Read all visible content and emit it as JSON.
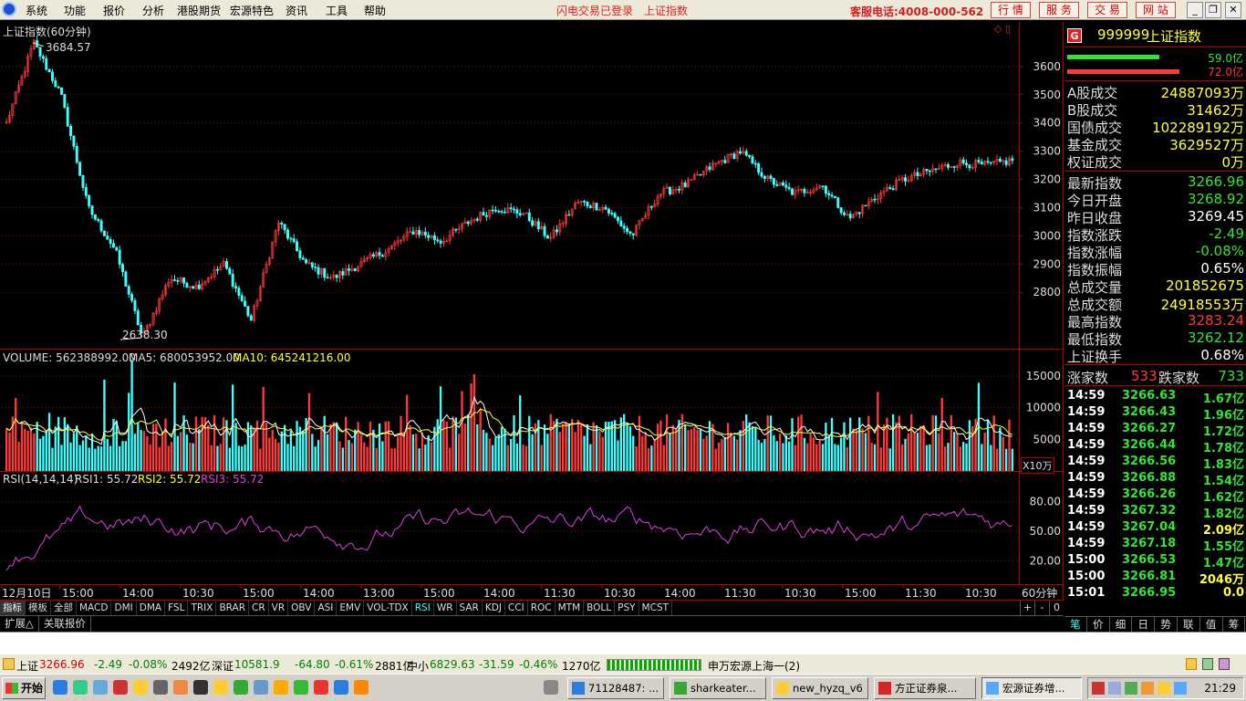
{
  "menubar": {
    "items": [
      "系统",
      "功能",
      "报价",
      "分析",
      "港股期货",
      "宏源特色",
      "资讯",
      "工具",
      "帮助"
    ],
    "status": "闪电交易已登录",
    "index_name": "上证指数",
    "hotline": "客服电话:4008-000-562",
    "buttons": [
      "行  情",
      "服  务",
      "交  易",
      "网  站"
    ],
    "window_buttons": [
      "_",
      "❐",
      "✕"
    ]
  },
  "chart": {
    "title": "上证指数(60分钟)",
    "top_icons": "◇ ▯",
    "high_label": "3684.57",
    "low_label": "2638.30",
    "volume_title": {
      "label": "VOLUME: 562388992.00",
      "ma5": "MA5: 680053952.00",
      "ma10": "MA10: 645241216.00"
    },
    "volume_unit": "X10万",
    "rsi_title": {
      "label": "RSI(14,14,14)",
      "rsi1": "RSI1: 55.72",
      "rsi2": "RSI2: 55.72",
      "rsi3": "RSI3: 55.72"
    },
    "period": "60分钟",
    "time_labels": [
      "12月10日",
      "15:00",
      "14:00",
      "10:30",
      "15:00",
      "14:00",
      "13:00",
      "15:00",
      "14:00",
      "11:30",
      "10:30",
      "14:00",
      "11:30",
      "10:30",
      "15:00",
      "11:30",
      "10:30"
    ]
  },
  "colors": {
    "up": "#ff3a3a",
    "down": "#40ffff",
    "grid": "#8a1010",
    "ma5": "#ffffff",
    "ma10": "#ffff40",
    "rsi": "#e040e0"
  },
  "chart_data": [
    {
      "type": "candlestick",
      "title": "上证指数(60分钟)",
      "y_ticks": [
        3600,
        3500,
        3400,
        3300,
        3200,
        3100,
        3000,
        2900,
        2800
      ],
      "ylim": [
        2600,
        3700
      ],
      "high": 3684.57,
      "low": 2638.3,
      "last": 3266.96,
      "trend_keypoints": [
        3400,
        3684.57,
        3500,
        3100,
        2950,
        2638.3,
        2850,
        2820,
        2900,
        2700,
        3050,
        2900,
        2850,
        2900,
        2950,
        3020,
        2980,
        3050,
        3100,
        3080,
        2990,
        3120,
        3100,
        3000,
        3150,
        3180,
        3250,
        3300,
        3200,
        3150,
        3180,
        3060,
        3140,
        3200,
        3230,
        3260,
        3250,
        3266.96
      ]
    },
    {
      "type": "bar",
      "title": "VOLUME",
      "volume": 562388992.0,
      "ma5": 680053952.0,
      "ma10": 645241216.0,
      "unit": "X10万",
      "y_ticks": [
        15000,
        10000,
        5000
      ],
      "ylim": [
        0,
        17000
      ]
    },
    {
      "type": "line",
      "title": "RSI(14,14,14)",
      "series": [
        {
          "name": "RSI1",
          "last": 55.72
        },
        {
          "name": "RSI2",
          "last": 55.72
        },
        {
          "name": "RSI3",
          "last": 55.72
        }
      ],
      "y_ticks": [
        "80.00",
        "50.00",
        "20.00"
      ],
      "ylim": [
        0,
        100
      ]
    }
  ],
  "indicator_tabs": [
    "指标",
    "模板",
    "全部",
    "MACD",
    "DMI",
    "DMA",
    "FSL",
    "TRIX",
    "BRAR",
    "CR",
    "VR",
    "OBV",
    "ASI",
    "EMV",
    "VOL-TDX",
    "RSI",
    "WR",
    "SAR",
    "KDJ",
    "CCI",
    "ROC",
    "MTM",
    "BOLL",
    "PSY",
    "MCST"
  ],
  "indicator_nav": [
    "+",
    "-",
    "0"
  ],
  "sub_tabs": [
    "扩展△",
    "关联报价"
  ],
  "quote": {
    "badge": "G",
    "code": "999999",
    "name": "上证指数",
    "bar_values": [
      "59.0亿",
      "72.0亿"
    ],
    "bar_fraction": [
      0.67,
      0.82
    ],
    "rows1": [
      {
        "label": "A股成交",
        "value": "24887093万",
        "color": "yellow"
      },
      {
        "label": "B股成交",
        "value": "31462万",
        "color": "yellow"
      },
      {
        "label": "国债成交",
        "value": "102289192万",
        "color": "yellow"
      },
      {
        "label": "基金成交",
        "value": "3629527万",
        "color": "yellow"
      },
      {
        "label": "权证成交",
        "value": "0万",
        "color": "yellow"
      }
    ],
    "rows2": [
      {
        "label": "最新指数",
        "value": "3266.96",
        "color": "green"
      },
      {
        "label": "今日开盘",
        "value": "3268.92",
        "color": "green"
      },
      {
        "label": "昨日收盘",
        "value": "3269.45",
        "color": "white"
      },
      {
        "label": "指数涨跌",
        "value": "-2.49",
        "color": "green"
      },
      {
        "label": "指数涨幅",
        "value": "-0.08%",
        "color": "green"
      },
      {
        "label": "指数振幅",
        "value": "0.65%",
        "color": "white"
      },
      {
        "label": "总成交量",
        "value": "201852675",
        "color": "yellow"
      },
      {
        "label": "总成交额",
        "value": "24918553万",
        "color": "yellow"
      },
      {
        "label": "最高指数",
        "value": "3283.24",
        "color": "red"
      },
      {
        "label": "最低指数",
        "value": "3262.12",
        "color": "green"
      },
      {
        "label": "上证换手",
        "value": "0.68%",
        "color": "white"
      }
    ],
    "up_label": "涨家数",
    "up_count": "533",
    "down_label": "跌家数",
    "down_count": "733",
    "ticks": [
      {
        "time": "14:59",
        "price": "3266.63",
        "amount": "1.67亿",
        "color": "green"
      },
      {
        "time": "14:59",
        "price": "3266.43",
        "amount": "1.96亿",
        "color": "green"
      },
      {
        "time": "14:59",
        "price": "3266.27",
        "amount": "1.72亿",
        "color": "green"
      },
      {
        "time": "14:59",
        "price": "3266.44",
        "amount": "1.78亿",
        "color": "green"
      },
      {
        "time": "14:59",
        "price": "3266.56",
        "amount": "1.83亿",
        "color": "green"
      },
      {
        "time": "14:59",
        "price": "3266.88",
        "amount": "1.54亿",
        "color": "green"
      },
      {
        "time": "14:59",
        "price": "3266.26",
        "amount": "1.62亿",
        "color": "green"
      },
      {
        "time": "14:59",
        "price": "3267.32",
        "amount": "1.82亿",
        "color": "green"
      },
      {
        "time": "14:59",
        "price": "3267.04",
        "amount": "2.09亿",
        "color": "yellow"
      },
      {
        "time": "14:59",
        "price": "3267.18",
        "amount": "1.55亿",
        "color": "green"
      },
      {
        "time": "15:00",
        "price": "3266.53",
        "amount": "1.47亿",
        "color": "green"
      },
      {
        "time": "15:00",
        "price": "3266.81",
        "amount": "2046万",
        "color": "yellow"
      },
      {
        "time": "15:01",
        "price": "3266.95",
        "amount": "0.0",
        "color": "yellow"
      }
    ],
    "tabs": [
      "笔",
      "价",
      "细",
      "日",
      "势",
      "联",
      "值",
      "筹"
    ]
  },
  "statusbar": {
    "sh_name": "上证",
    "sh_value": "3266.96",
    "sh_chg": "-2.49",
    "sh_pct": "-0.08%",
    "sh_amt": "2492亿",
    "sz_name": "深证",
    "sz_value": "10581.9",
    "sz_chg": "-64.80",
    "sz_pct": "-0.61%",
    "sz_amt": "2881亿",
    "zx_name": "中小",
    "zx_value": "6829.63",
    "zx_chg": "-31.59",
    "zx_pct": "-0.46%",
    "zx_amt": "1270亿",
    "server": "申万宏源上海一(2)"
  },
  "taskbar": {
    "start": "开始",
    "tasks": [
      "71128487: ...",
      "sharkeater...",
      "new_hyzq_v6",
      "方正证券泉...",
      "宏源证券增..."
    ],
    "clock": "21:29"
  }
}
